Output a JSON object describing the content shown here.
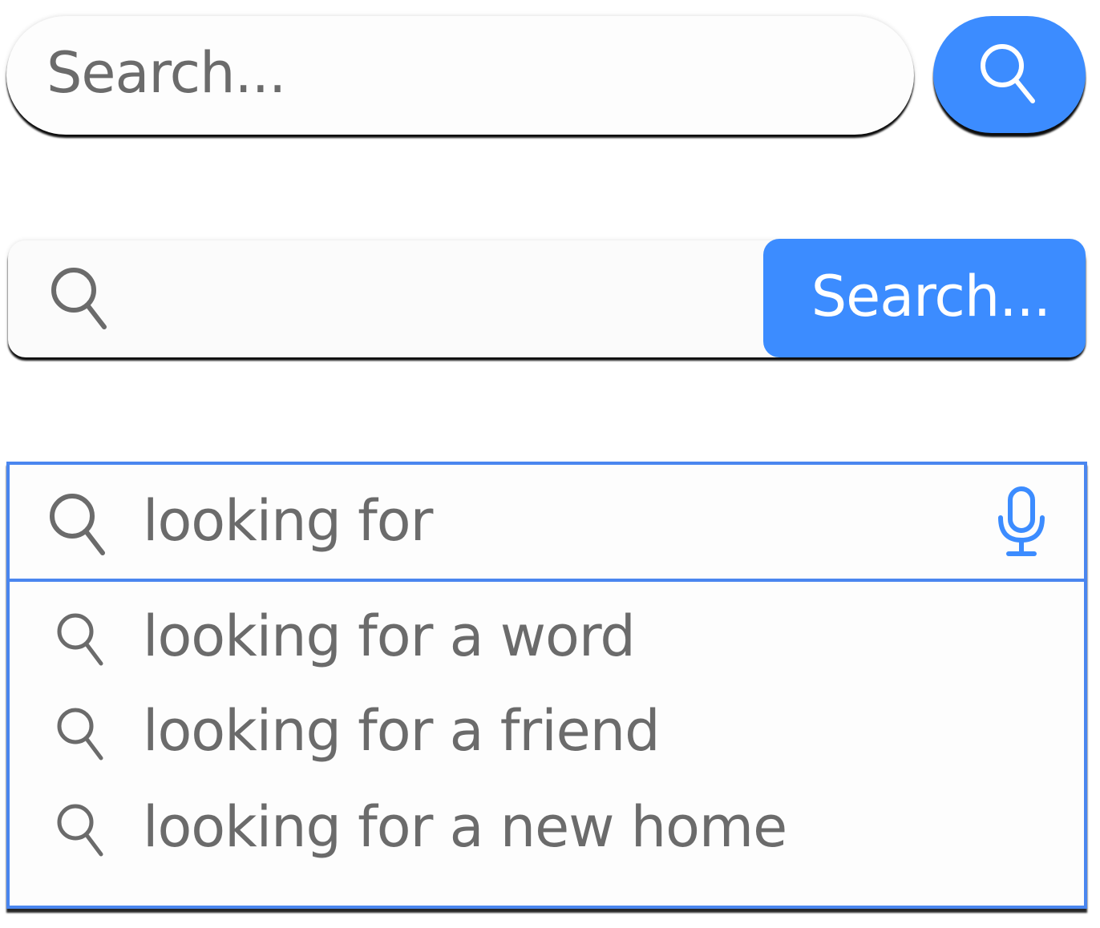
{
  "colors": {
    "accent": "#3c8cff",
    "border": "#4a86ef",
    "text": "#6b6b6b",
    "background": "#ffffff"
  },
  "search_bar_1": {
    "placeholder": "Search...",
    "button_icon": "search-icon"
  },
  "search_bar_2": {
    "input_icon": "search-icon",
    "button_label": "Search..."
  },
  "autocomplete": {
    "input_icon": "search-icon",
    "value": "looking for",
    "mic_icon": "microphone-icon",
    "suggestions": [
      {
        "icon": "search-icon",
        "label": "looking for a word"
      },
      {
        "icon": "search-icon",
        "label": "looking for a friend"
      },
      {
        "icon": "search-icon",
        "label": "looking for a new home"
      }
    ]
  }
}
